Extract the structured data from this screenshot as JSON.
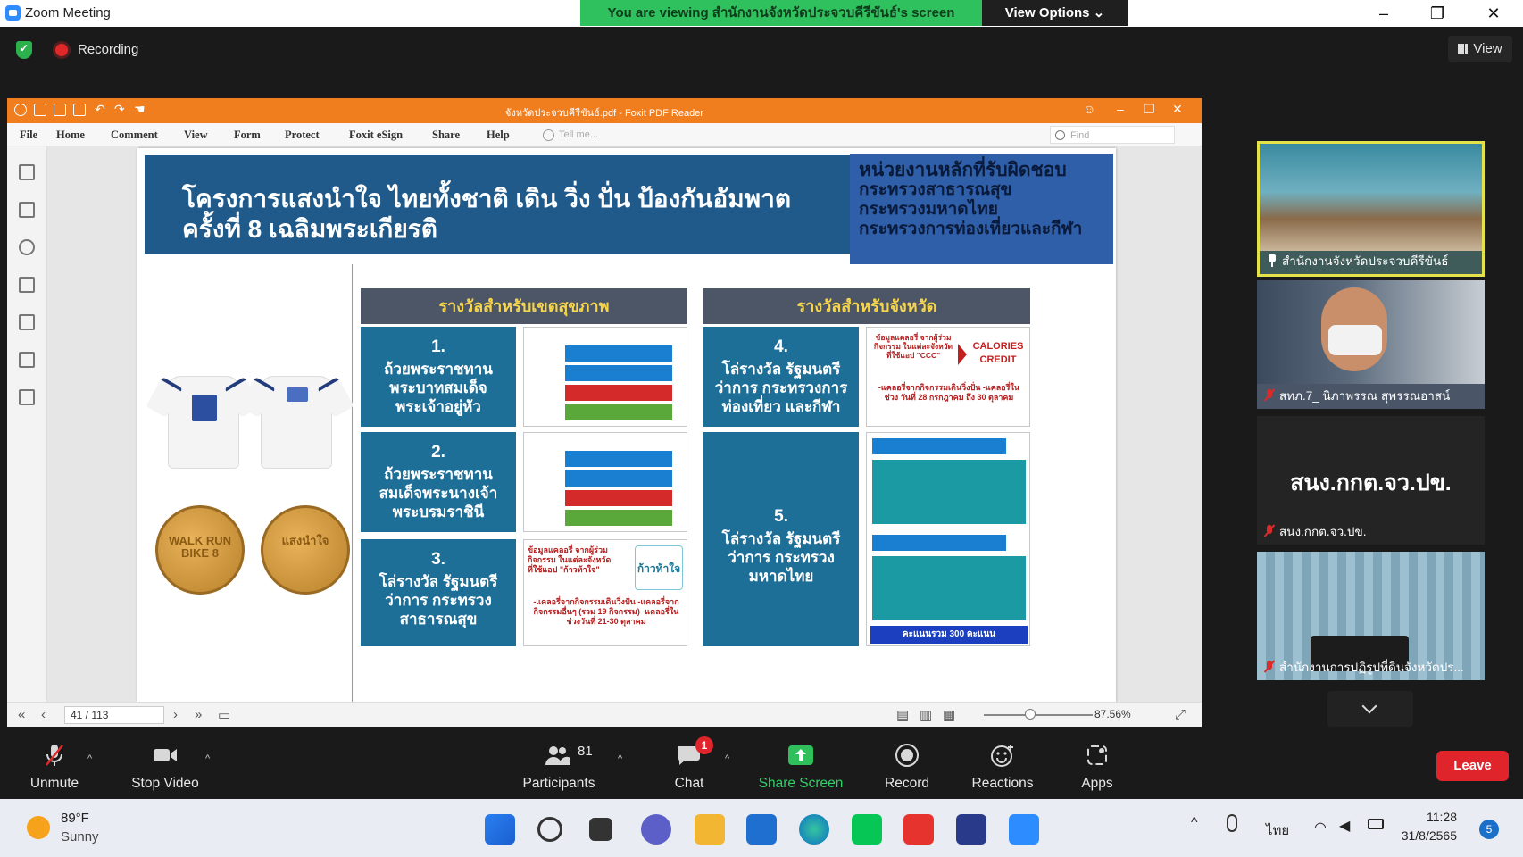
{
  "window": {
    "title": "Zoom Meeting"
  },
  "share_banner": "You are viewing สำนักงานจังหวัดประจวบคีรีขันธ์'s screen",
  "view_options_label": "View Options ⌄",
  "recording_label": "Recording",
  "view_label": "View",
  "foxit": {
    "doc_title": "จังหวัดประจวบคีรีขันธ์.pdf - Foxit PDF Reader",
    "menu": [
      "File",
      "Home",
      "Comment",
      "View",
      "Form",
      "Protect",
      "Foxit eSign",
      "Share",
      "Help"
    ],
    "tellme_placeholder": "Tell me...",
    "find_placeholder": "Find",
    "page_indicator": "41 / 113",
    "zoom": "87.56%"
  },
  "slide": {
    "title_line1": "โครงการแสงนำใจ ไทยทั้งชาติ เดิน วิ่ง ปั่น ป้องกันอัมพาต",
    "title_line2": "ครั้งที่ 8 เฉลิมพระเกียรติ",
    "responsible_title": "หน่วยงานหลักที่รับผิดชอบ",
    "responsible": [
      "กระทรวงสาธารณสุข",
      "กระทรวงมหาดไทย",
      "กระทรวงการท่องเที่ยวและกีฬา"
    ],
    "col1_head": "รางวัลสำหรับเขตสุขภาพ",
    "col2_head": "รางวัลสำหรับจังหวัด",
    "awards": [
      {
        "num": "1.",
        "text": "ถ้วยพระราชทาน พระบาทสมเด็จพระเจ้าอยู่หัว"
      },
      {
        "num": "2.",
        "text": "ถ้วยพระราชทาน สมเด็จพระนางเจ้า พระบรมราชินี"
      },
      {
        "num": "3.",
        "text": "โล่รางวัล รัฐมนตรีว่าการ กระทรวงสาธารณสุข"
      },
      {
        "num": "4.",
        "text": "โล่รางวัล รัฐมนตรีว่าการ กระทรวงการท่องเที่ยว และกีฬา"
      },
      {
        "num": "5.",
        "text": "โล่รางวัล รัฐมนตรีว่าการ กระทรวงมหาดไทย"
      }
    ],
    "calories_credit": "CALORIES CREDIT",
    "calories_note": "-แคลอรี่จากกิจกรรมเดินวิ่งปั่น -แคลอรี่ในช่วง วันที่ 28 กรกฎาคม ถึง 30 ตุลาคม",
    "score_total": "คะแนนรวม 300 คะแนน",
    "award3_note": "-แคลอรี่จากกิจกรรมเดินวิ่งปั่น -แคลอรี่จากกิจกรรมอื่นๆ (รวม 19 กิจกรรม) -แคลอรี่ในช่วงวันที่ 21-30 ตุลาคม",
    "award3_data": "ข้อมูลแคลอรี่ จากผู้ร่วมกิจกรรม ในแต่ละจังหวัด ที่ใช้แอป \"ก้าวท้าใจ\"",
    "award4_data": "ข้อมูลแคลอรี่ จากผู้ร่วมกิจกรรม ในแต่ละจังหวัด ที่ใช้แอป \"CCC\"",
    "kaotajai_logo": "ก้าวท้าใจ",
    "medal1_text": "WALK RUN BIKE 8",
    "medal2_text": "แสงนำใจ"
  },
  "participants": [
    {
      "name": "สำนักงานจังหวัดประจวบคีรีขันธ์",
      "pinned": true
    },
    {
      "name": "สทภ.7_ นิภาพรรณ สุพรรณอาสน์",
      "muted": true
    },
    {
      "name": "สนง.กกต.จว.ปข.",
      "display": "สนง.กกต.จว.ปข.",
      "muted": true
    },
    {
      "name": "สำนักงานการปฏิรูปที่ดินจังหวัดปร...",
      "muted": true
    }
  ],
  "toolbar": {
    "unmute": "Unmute",
    "stop_video": "Stop Video",
    "participants": "Participants",
    "participants_count": "81",
    "chat": "Chat",
    "chat_badge": "1",
    "share_screen": "Share Screen",
    "record": "Record",
    "reactions": "Reactions",
    "apps": "Apps",
    "leave": "Leave"
  },
  "taskbar": {
    "weather_temp": "89°F",
    "weather_desc": "Sunny",
    "language": "ไทย",
    "time": "11:28",
    "date": "31/8/2565",
    "notifications": "5"
  },
  "colors": {
    "zoom_green": "#30c15f",
    "foxit_orange": "#f07d1e",
    "slide_blue": "#1f5a8a",
    "award_teal": "#1d6f98",
    "leave_red": "#e0242b"
  }
}
